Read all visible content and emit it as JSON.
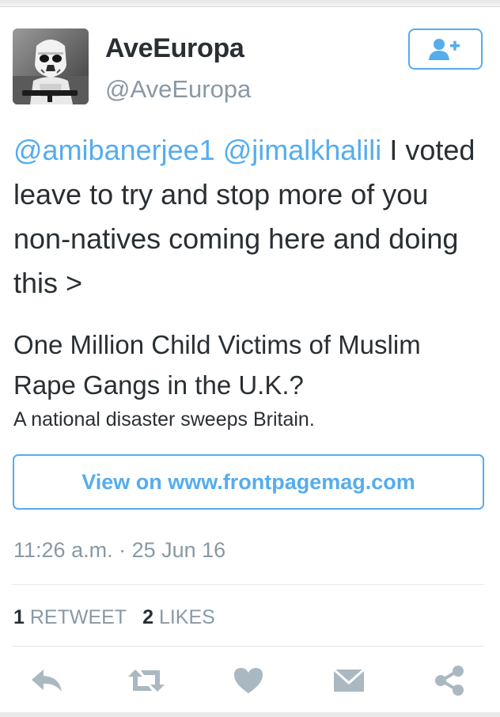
{
  "user": {
    "display_name": "AveEuropa",
    "handle": "@AveEuropa",
    "avatar_icon": "stormtrooper-avatar"
  },
  "follow_button": {
    "icon": "follow-user-plus-icon"
  },
  "tweet": {
    "mention_1": "@amibanerjee1",
    "mention_2": "@jimalkhalili",
    "text": "I voted leave to try and stop more of you non-natives coming here and doing this >"
  },
  "card": {
    "title": "One Million Child Victims of Muslim Rape Gangs in the U.K.?",
    "description": "A national disaster sweeps Britain.",
    "view_label": "View on www.frontpagemag.com"
  },
  "timestamp": "11:26 a.m. · 25 Jun 16",
  "stats": {
    "retweets_count": "1",
    "retweets_label": "RETWEET",
    "likes_count": "2",
    "likes_label": "LIKES"
  },
  "actions": [
    "reply-icon",
    "retweet-icon",
    "like-heart-icon",
    "direct-message-icon",
    "share-icon"
  ],
  "colors": {
    "accent": "#55acee",
    "text": "#292f33",
    "muted": "#8899a6",
    "action_icon": "#aab8c2"
  }
}
